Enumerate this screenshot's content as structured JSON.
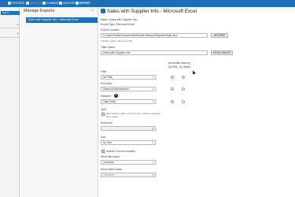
{
  "toolbar": {
    "items": [
      {
        "label": "PREVIEW",
        "style": "normal"
      },
      {
        "label": "SEARCH",
        "style": "dim"
      },
      {
        "label": "COMBINE",
        "style": "normal"
      },
      {
        "label": "ANALYZE",
        "style": "normal"
      },
      {
        "label": "EXPORT",
        "style": "active"
      }
    ],
    "color": "#1e6fb8"
  },
  "left_pane": {
    "search_label": "Export",
    "plus": "+"
  },
  "middle_pane": {
    "title": "Manage Exports",
    "close": "×",
    "selected_item": "Sales with Supplier Info - Microsoft Excel"
  },
  "dialog": {
    "title": "Sales with Supplier Info - Microsoft Excel",
    "name_line": "Name: Sales with Supplier Info",
    "export_type_line": "Export Type: Microsoft Excel",
    "export_location_label": "Export Location",
    "export_location_value": "C:\\Users\\Public\\Documents\\Allocate Monarch\\Exports\\Sales.xlsx",
    "export_location_note": "The file location does not exist",
    "browse_button": "BROWSE",
    "table_name_label": "Table Name",
    "table_name_value": "Sales with Supplier Info",
    "show_tables_button": "SHOW TABLES",
    "auto_naming_label": "Automatic Naming",
    "auto_by_files": "by Files",
    "auto_by_tables": "by Tables",
    "filter_label": "Filter",
    "filter_value": "No Filter",
    "summary_label": "Summary",
    "summary_value": "Sales by Manufacturer",
    "measure_label": "Measure",
    "measure_value": "Total Sales",
    "help": "?",
    "split_label": "Split",
    "split_check_text": "Each distinct value of the first key makes a separate file or table.",
    "drill_level_label": "Drill Level",
    "drill_level_value": "",
    "sort_label": "Sort",
    "sort_value": "No Sort",
    "include_headers_label": "Include Column Headers",
    "when_file_exists_label": "When file exists:",
    "when_file_exists_value": "Overwrite",
    "when_table_exists_label": "When table exists:",
    "when_table_exists_value": "Overwrite",
    "chevron": "▾"
  }
}
